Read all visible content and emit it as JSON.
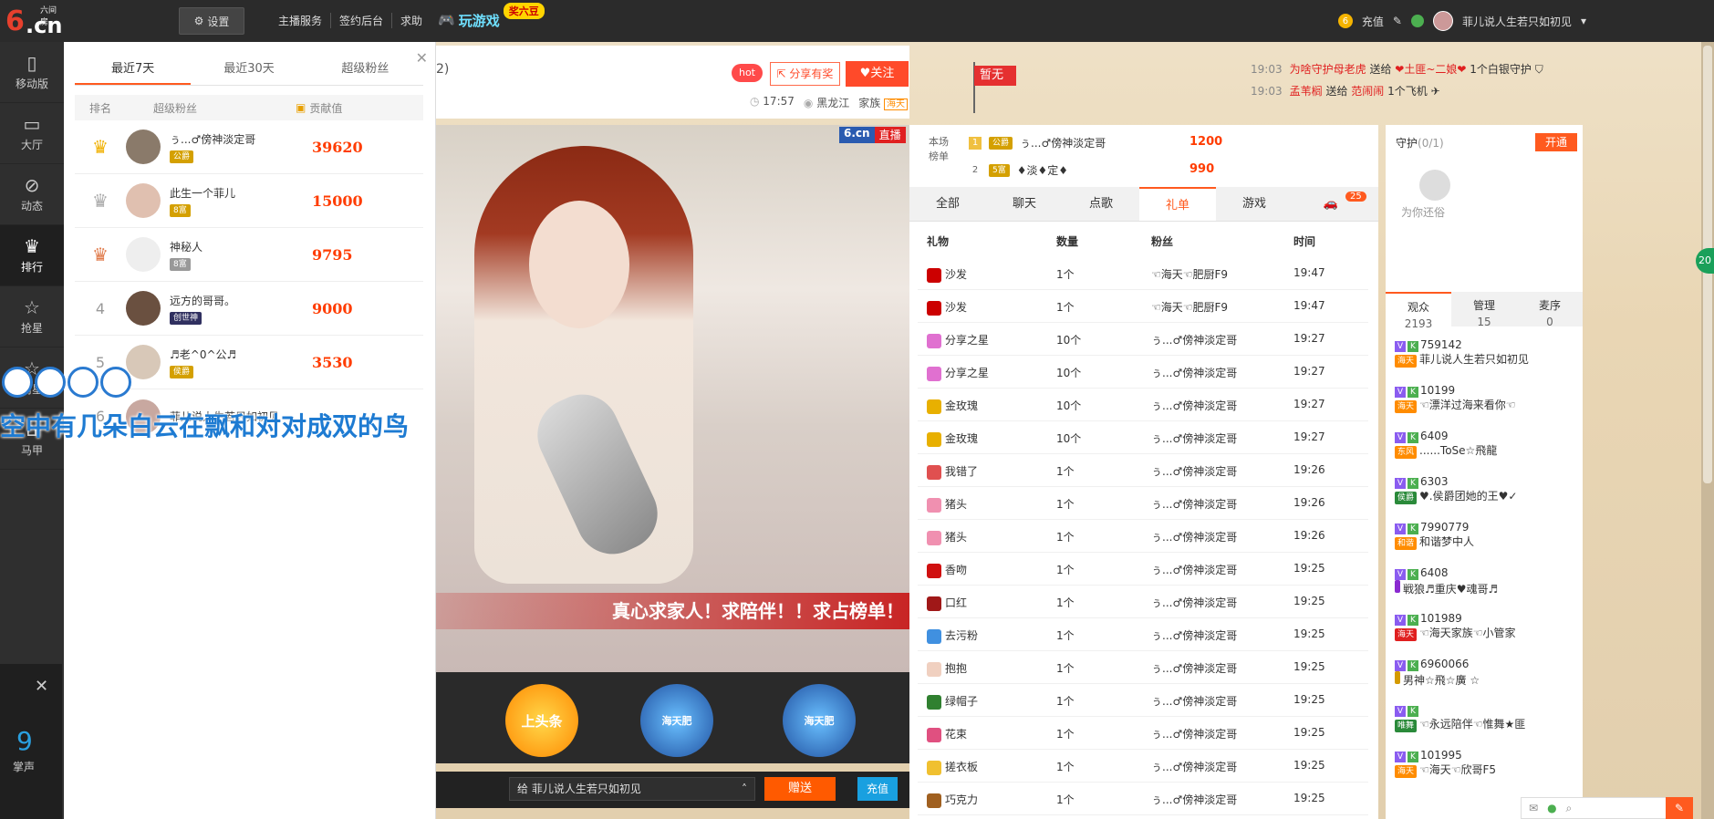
{
  "topbar": {
    "logo_sub": "六间房",
    "logo_six": "6",
    "logo_cn": ".cn",
    "settings": "设置",
    "links": [
      "主播服务",
      "签约后台",
      "求助"
    ],
    "game_label": "玩游戏",
    "game_badge": "奖六豆",
    "recharge": "充值",
    "username": "菲儿说人生若只如初见"
  },
  "leftnav": [
    {
      "label": "移动版",
      "icon": "phone-icon"
    },
    {
      "label": "大厅",
      "icon": "tv-icon"
    },
    {
      "label": "动态",
      "icon": "compass-icon"
    },
    {
      "label": "排行",
      "icon": "crown-icon"
    },
    {
      "label": "抢星",
      "icon": "star-icon"
    },
    {
      "label": "周星",
      "icon": "star-icon"
    },
    {
      "label": "马甲",
      "icon": "vest-icon"
    }
  ],
  "rank_panel": {
    "tabs": [
      "最近7天",
      "最近30天",
      "超级粉丝"
    ],
    "active_tab": 0,
    "head": {
      "rank": "排名",
      "fans": "超级粉丝",
      "value": "贡献值"
    },
    "rows": [
      {
        "rank": "1",
        "name": "ぅ...♂傍神淡定哥",
        "level": "公爵",
        "score": "39620"
      },
      {
        "rank": "2",
        "name": "此生一个菲儿",
        "level": "8富",
        "score": "15000"
      },
      {
        "rank": "3",
        "name": "神秘人",
        "level": "8富",
        "score": "9795"
      },
      {
        "rank": "4",
        "name": "远方的哥哥。",
        "level": "创世神",
        "score": "9000"
      },
      {
        "rank": "5",
        "name": "♬老^0^公♬",
        "level": "侯爵",
        "score": "3530"
      },
      {
        "rank": "6",
        "name": "菲儿说人生若只如初见",
        "level": "",
        "score": ""
      }
    ]
  },
  "lyric": "空中有几朵白云在飘和对对成双的鸟",
  "bottom_left": {
    "count": "9",
    "label": "掌声"
  },
  "room_info": {
    "hot": "hot",
    "share": "分享有奖",
    "follow": "关注",
    "time": "17:57",
    "location": "黑龙江",
    "family_label": "家族",
    "family_name": "海天",
    "title_frag": "2)"
  },
  "flag": "暂无",
  "gift_messages": [
    {
      "time": "19:03",
      "from": "为啥守护母老虎",
      "verb": "送给",
      "to": "❤土匪~二娘❤",
      "gift": "1个白银守护"
    },
    {
      "time": "19:03",
      "from": "孟苇榈",
      "verb": "送给",
      "to": "范闹闹",
      "gift": "1个飞机"
    }
  ],
  "video": {
    "logo": "6.cn",
    "live": "直播",
    "banner": "真心求家人！求陪伴！！求占榜单！",
    "gift_top": "上头条",
    "gift_label_1": "海天肥",
    "gift_label_2": "海天肥"
  },
  "send_bar": {
    "to_label": "给",
    "to_name": "菲儿说人生若只如初见",
    "send": "赠送",
    "recharge": "充值"
  },
  "scene_rank": {
    "label": "本场榜单",
    "rows": [
      {
        "num": "1",
        "badge": "公爵",
        "name": "ぅ...♂傍神淡定哥",
        "score": "1200"
      },
      {
        "num": "2",
        "badge": "5富",
        "name": "♦淡♦定♦",
        "score": "990"
      }
    ]
  },
  "chat_tabs": [
    "全部",
    "聊天",
    "点歌",
    "礼单",
    "游戏"
  ],
  "active_chat_tab": 3,
  "car_count": "25",
  "gift_head": {
    "gift": "礼物",
    "count": "数量",
    "fan": "粉丝",
    "time": "时间"
  },
  "gifts": [
    {
      "gift": "沙发",
      "count": "1个",
      "fan": "☜海天☜肥厨F9",
      "time": "19:47",
      "color": "#c00"
    },
    {
      "gift": "沙发",
      "count": "1个",
      "fan": "☜海天☜肥厨F9",
      "time": "19:47",
      "color": "#c00"
    },
    {
      "gift": "分享之星",
      "count": "10个",
      "fan": "ぅ...♂傍神淡定哥",
      "time": "19:27",
      "color": "#e070d0"
    },
    {
      "gift": "分享之星",
      "count": "10个",
      "fan": "ぅ...♂傍神淡定哥",
      "time": "19:27",
      "color": "#e070d0"
    },
    {
      "gift": "金玫瑰",
      "count": "10个",
      "fan": "ぅ...♂傍神淡定哥",
      "time": "19:27",
      "color": "#e8b000"
    },
    {
      "gift": "金玫瑰",
      "count": "10个",
      "fan": "ぅ...♂傍神淡定哥",
      "time": "19:27",
      "color": "#e8b000"
    },
    {
      "gift": "我错了",
      "count": "1个",
      "fan": "ぅ...♂傍神淡定哥",
      "time": "19:26",
      "color": "#e05050"
    },
    {
      "gift": "猪头",
      "count": "1个",
      "fan": "ぅ...♂傍神淡定哥",
      "time": "19:26",
      "color": "#f090b0"
    },
    {
      "gift": "猪头",
      "count": "1个",
      "fan": "ぅ...♂傍神淡定哥",
      "time": "19:26",
      "color": "#f090b0"
    },
    {
      "gift": "香吻",
      "count": "1个",
      "fan": "ぅ...♂傍神淡定哥",
      "time": "19:25",
      "color": "#d01010"
    },
    {
      "gift": "口红",
      "count": "1个",
      "fan": "ぅ...♂傍神淡定哥",
      "time": "19:25",
      "color": "#a01818"
    },
    {
      "gift": "去污粉",
      "count": "1个",
      "fan": "ぅ...♂傍神淡定哥",
      "time": "19:25",
      "color": "#4090e0"
    },
    {
      "gift": "抱抱",
      "count": "1个",
      "fan": "ぅ...♂傍神淡定哥",
      "time": "19:25",
      "color": "#f0d0c0"
    },
    {
      "gift": "绿帽子",
      "count": "1个",
      "fan": "ぅ...♂傍神淡定哥",
      "time": "19:25",
      "color": "#308030"
    },
    {
      "gift": "花束",
      "count": "1个",
      "fan": "ぅ...♂傍神淡定哥",
      "time": "19:25",
      "color": "#e05080"
    },
    {
      "gift": "搓衣板",
      "count": "1个",
      "fan": "ぅ...♂傍神淡定哥",
      "time": "19:25",
      "color": "#f0c030"
    },
    {
      "gift": "巧克力",
      "count": "1个",
      "fan": "ぅ...♂傍神淡定哥",
      "time": "19:25",
      "color": "#a06020"
    }
  ],
  "guard": {
    "title": "守护",
    "count": "(0/1)",
    "open": "开通",
    "hint": "为你还俗"
  },
  "aud_tabs": [
    {
      "label": "观众",
      "num": "2193"
    },
    {
      "label": "管理",
      "num": "15"
    },
    {
      "label": "麦序",
      "num": "0"
    }
  ],
  "audience": [
    {
      "tag": "海天",
      "lvl": "2",
      "id": "759142",
      "name": "菲儿说人生若只如初见"
    },
    {
      "tag": "海天",
      "lvl": "",
      "id": "10199",
      "name": "☜漂洋过海来看你☜"
    },
    {
      "tag": "东风",
      "lvl": "",
      "id": "6409",
      "name": "......ToSe☆飛龍"
    },
    {
      "tag": "侯爵",
      "lvl": "",
      "id": "6303",
      "name": "♥.侯爵团她的王♥✓"
    },
    {
      "tag": "和谐",
      "lvl": "",
      "id": "7990779",
      "name": "和谐梦中人"
    },
    {
      "tag": "",
      "lvl": "",
      "id": "6408",
      "name": "戦狼♬重庆♥魂哥♬"
    },
    {
      "tag": "海天",
      "lvl": "",
      "id": "101989",
      "name": "☜海天家族☜小管家"
    },
    {
      "tag": "",
      "lvl": "",
      "id": "6960066",
      "name": "男神☆飛☆廣 ☆"
    },
    {
      "tag": "唯舞",
      "lvl": "",
      "id": "",
      "name": "☜永远陪伴☜惟舞★匪"
    },
    {
      "tag": "海天",
      "lvl": "",
      "id": "101995",
      "name": "☜海天☜欣哥F5"
    }
  ],
  "side_badge": "20"
}
